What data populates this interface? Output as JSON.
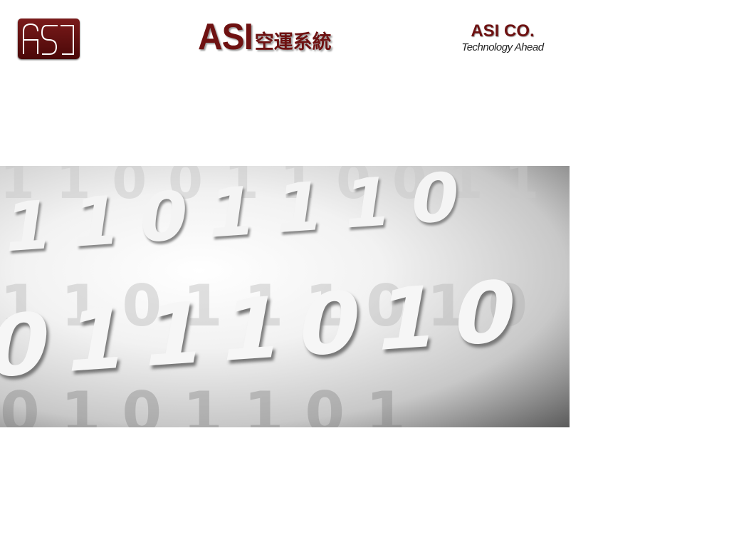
{
  "header": {
    "logo_text": "ASI",
    "title_latin": "ASI",
    "title_cjk": "空運系統",
    "company_name": "ASI CO.",
    "slogan": "Technology Ahead"
  },
  "banner": {
    "rows": [
      "1100110011",
      "1101110",
      "0111010",
      "110111010",
      "0101101"
    ]
  },
  "colors": {
    "brand": "#6e1111"
  }
}
